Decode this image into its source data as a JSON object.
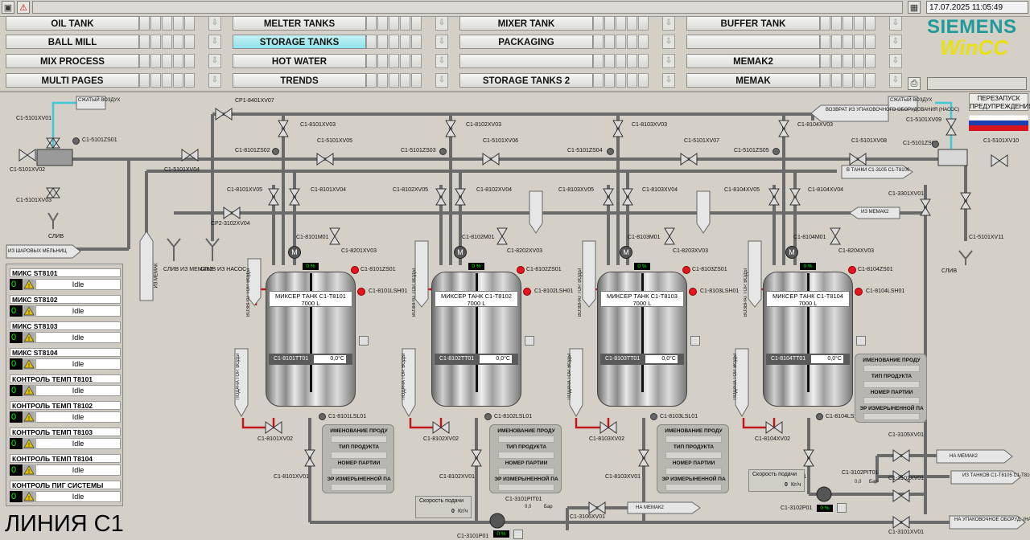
{
  "header": {
    "datetime": "17.07.2025 11:05:49"
  },
  "nav": {
    "col1": [
      "OIL TANK",
      "BALL MILL",
      "MIX PROCESS",
      "MULTI PAGES"
    ],
    "col2": [
      "MELTER TANKS",
      "STORAGE TANKS",
      "HOT WATER",
      "TRENDS"
    ],
    "col3": [
      "MIXER TANK",
      "PACKAGING",
      "",
      "STORAGE TANKS 2"
    ],
    "col4": [
      "BUFFER TANK",
      "",
      "MEMAK2",
      "MEMAK"
    ],
    "active": "STORAGE TANKS"
  },
  "logo": {
    "brand": "SIEMENS",
    "product": "WinCC"
  },
  "restart_label": "ПЕРЕЗАПУСК ПРЕДУПРЕЖДЕНИЯ",
  "status_panel": [
    {
      "label": "МИКС ST8101",
      "count": "0",
      "state": "Idle"
    },
    {
      "label": "МИКС ST8102",
      "count": "0",
      "state": "Idle"
    },
    {
      "label": "МИКС ST8103",
      "count": "0",
      "state": "Idle"
    },
    {
      "label": "МИКС ST8104",
      "count": "0",
      "state": "Idle"
    },
    {
      "label": "КОНТРОЛЬ ТЕМП T8101",
      "count": "0",
      "state": "Idle"
    },
    {
      "label": "КОНТРОЛЬ ТЕМП T8102",
      "count": "0",
      "state": "Idle"
    },
    {
      "label": "КОНТРОЛЬ ТЕМП T8103",
      "count": "0",
      "state": "Idle"
    },
    {
      "label": "КОНТРОЛЬ ТЕМП T8104",
      "count": "0",
      "state": "Idle"
    },
    {
      "label": "КОНТРОЛЬ ПИГ СИСТЕМЫ",
      "count": "0",
      "state": "Idle"
    }
  ],
  "line_title": "ЛИНИЯ C1",
  "tanks": [
    {
      "name": "МИКСЕР ТАНК C1-T8101",
      "volume": "7000 L",
      "tt_tag": "C1-8101TT01",
      "temp": "0,0°C",
      "level": "0 %",
      "motor_tag": "C1-8101M01",
      "zs_tag": "C1-8101ZS01",
      "lsh_tag": "C1-8101LSH01",
      "lsl_tag": "C1-8101LSL01",
      "bottom_valve": "C1-8101XV02",
      "out_valve": "C1-8101XV01",
      "top_valve": "C1-8101XV03",
      "v05": "C1-8101XV05",
      "v04": "C1-8101XV04",
      "v8201": "C1-8201XV03"
    },
    {
      "name": "МИКСЕР ТАНК C1-T8102",
      "volume": "7000 L",
      "tt_tag": "C1-8102TT01",
      "temp": "0,0°C",
      "level": "0 %",
      "motor_tag": "C1-8102M01",
      "zs_tag": "C1-8102ZS01",
      "lsh_tag": "C1-8102LSH01",
      "lsl_tag": "C1-8102LSL01",
      "bottom_valve": "C1-8102XV02",
      "out_valve": "C1-8102XV01",
      "top_valve": "C1-8102XV03",
      "v05": "C1-8102XV05",
      "v04": "C1-8102XV04",
      "v8201": "C1-8202XV03"
    },
    {
      "name": "МИКСЕР ТАНК C1-T8103",
      "volume": "7000 L",
      "tt_tag": "C1-8103TT01",
      "temp": "0,0°C",
      "level": "0 %",
      "motor_tag": "C1-8103M01",
      "zs_tag": "C1-8103ZS01",
      "lsh_tag": "C1-8103LSH01",
      "lsl_tag": "C1-8103LSL01",
      "bottom_valve": "C1-8103XV02",
      "out_valve": "C1-8103XV01",
      "top_valve": "C1-8103XV03",
      "v05": "C1-8103XV05",
      "v04": "C1-8103XV04",
      "v8201": "C1-8203XV03"
    },
    {
      "name": "МИКСЕР ТАНК C1-T8104",
      "volume": "7000 L",
      "tt_tag": "C1-8104TT01",
      "temp": "0,0°C",
      "level": "0 %",
      "motor_tag": "C1-8104M01",
      "zs_tag": "C1-8104ZS01",
      "lsh_tag": "C1-8104LSH01",
      "lsl_tag": "C1-8104LSL01",
      "bottom_valve": "C1-8104XV02",
      "out_valve": "C1-8104XV01",
      "top_valve": "C1-8104XV03",
      "v05": "C1-8104XV05",
      "v04": "C1-8104XV04",
      "v8201": "C1-8204XV03"
    }
  ],
  "product_panel": {
    "title": "ИМЕНОВАНИЕ ПРОДУ",
    "type": "ТИП ПРОДУКТА",
    "batch": "НОМЕР ПАРТИИ",
    "measured": "ЭР ИЗМЕРЫНЕННОЙ ПА"
  },
  "speed": {
    "label": "Скорость подачи",
    "value": "0",
    "unit": "Кг/ч"
  },
  "pressure": {
    "tag1": "C1-3101PIT01",
    "tag2": "C1-3102PIT01",
    "value": "0,0",
    "unit": "Бар"
  },
  "pumps": {
    "p1": "C1-3101P01",
    "p2": "C1-3102P01",
    "level": "0 %"
  },
  "top_left": {
    "air": "СЖАТЫЙ ВОЗДУХ",
    "v01": "C1-5101XV01",
    "zs01": "C1-5101ZS01",
    "v02": "C1-5101XV02",
    "v03": "C1-5101XV03",
    "drain": "СЛИВ",
    "from_mill": "ИЗ ШАРОВЫХ МЕЛЬНИЦ",
    "v04": "C1-5101XV04",
    "v05": "C1-5101XV05",
    "cp1": "CP1-8401XV07",
    "cp2": "CP2-3102XV04",
    "zs02": "C1-8101ZS02",
    "drain_memak2": "СЛИВ ИЗ МЕМАК2",
    "drain_pump": "СЛИВ ИЗ НАСОС",
    "memak": "ИЗ МЕМАК"
  },
  "top_right": {
    "air": "СЖАТЫЙ ВОЗДУХ",
    "v09": "C1-5101XV09",
    "zs08": "C1-5101ZS08",
    "v10": "C1-5101XV10",
    "v11": "C1-5101XV11",
    "drain": "СЛИВ",
    "return_pack": "ВОЗВРАТ ИЗ УПАКОВОЧНОГО ОБОРУДОВАНИЯ (НАСОС)",
    "to_tanks": "В ТАНКИ C1-3105 C1-T8106",
    "from_memak": "ИЗ МЕМАК2",
    "v3301": "C1-3301XV01",
    "zs03": "C1-5101ZS03",
    "v06": "C1-5101XV06",
    "zs04": "C1-5101ZS04",
    "v07": "C1-5101XV07",
    "zs05": "C1-5101ZS05",
    "v08": "C1-5101XV08"
  },
  "bottom_right": {
    "v3105": "C1-3105XV01",
    "to_memak2": "НА МЕМАК2",
    "v3102": "C1-3102XV01",
    "from_tanks": "ИЗ ТАНКОВ C1-T8105 C1-T8106",
    "v3101": "C1-3101XV01",
    "to_pack": "НА УПАКОВОЧНОЕ ОБОРУД. (НАСОС)",
    "v3106": "C1-3106XV01",
    "to_memak": "НА МЕМАК2"
  },
  "side_flags": {
    "hot_water_in": "ПОДАЧА ГОР. ВОДЫ",
    "hot_water_out": "ВОЗВРАТ ГОР. ВОДЫ"
  }
}
